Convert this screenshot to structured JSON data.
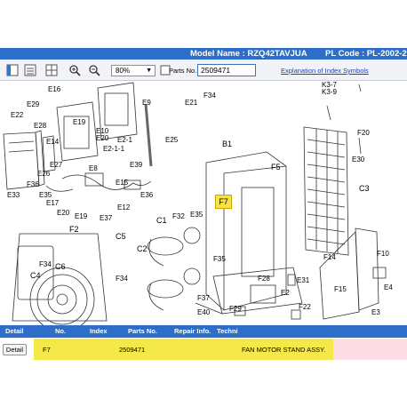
{
  "header": {
    "model_name": "Model Name : RZQ42TAVJUA",
    "pl_code": "PL Code : PL-2002-2"
  },
  "toolbar": {
    "zoom_value": "80%",
    "parts_no_label": "Parts No.",
    "parts_no_value": "2509471",
    "explanation_link": "Explanation of Index Symbols",
    "icons": [
      "panel-toggle-icon",
      "list-icon",
      "grid-icon",
      "zoom-in-icon",
      "zoom-out-icon",
      "fit-page-icon"
    ]
  },
  "diagram": {
    "labels": [
      "E16",
      "E21",
      "F34",
      "K3-9",
      "K3-7",
      "E22",
      "E29",
      "E28",
      "E14",
      "E27",
      "E19",
      "E9",
      "E10",
      "E20",
      "E2-1",
      "E2-1-1",
      "E25",
      "E8",
      "E39",
      "E33",
      "F36",
      "E35",
      "E26",
      "E17",
      "E15",
      "E12",
      "E36",
      "E37",
      "E20",
      "E19",
      "B1",
      "F20",
      "E30",
      "F5",
      "C3",
      "F7",
      "F32",
      "E35",
      "C1",
      "F2",
      "C5",
      "C2",
      "F34",
      "C6",
      "C4",
      "F34",
      "F35",
      "F37",
      "F28",
      "E31",
      "E2",
      "F29",
      "E40",
      "F22",
      "F14",
      "F15",
      "F10",
      "E4",
      "E3"
    ],
    "highlight_label": "F7"
  },
  "table": {
    "columns": [
      "Detail",
      "No.",
      "Index",
      "Parts No.",
      "Repair Info.",
      "Techni",
      "Description"
    ],
    "row": {
      "detail_button": "Detail",
      "no": "F7",
      "index": "",
      "parts_no": "2509471",
      "repair_info": "",
      "description": "FAN MOTOR STAND ASSY."
    }
  },
  "colors": {
    "accent": "#2d6fc8",
    "highlight": "#f5e849",
    "row_pink": "#fbdde3"
  }
}
